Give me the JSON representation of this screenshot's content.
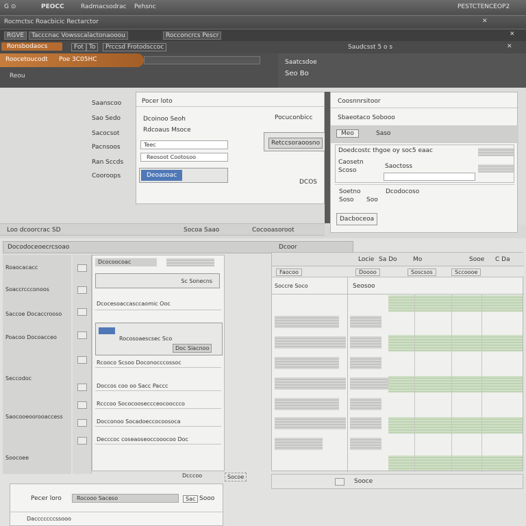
{
  "window": {
    "title": "PEOCC",
    "left_icons": "G ⊙",
    "title_menu": "Radmacsodrac",
    "title_right_label": "Pehsnc",
    "top_right": "PESTCTENCEOP2"
  },
  "toolbar2": {
    "left_text": "Rocmctsc Roacbicic Rectarctor",
    "right_glyph": "✕"
  },
  "menubar": {
    "items": [
      "RGVE",
      "Tacccnac Vowsscalactonaooou",
      "Rocconcrcs Pescr"
    ],
    "close": "✕"
  },
  "tabbar": {
    "tab1": "Ronsbodaocs",
    "tab2_a": "Fot",
    "tab2_b": "To",
    "tab2_c": "Prccsd Frotodsccoc",
    "right_text": "Saudcsst 5 o s",
    "close": "✕"
  },
  "top_left": {
    "highlight": "Roocetoucodt",
    "highlight_value": "Poe 3C05HC",
    "link": "Reou"
  },
  "top_right": {
    "label": "Saatcsdoe",
    "value": "Seo Bo"
  },
  "form": {
    "labels": [
      "Saanscoo",
      "Sao Sedo",
      "Sacocsot",
      "Pacnsoos",
      "Ran Sccds",
      "Cooroops"
    ],
    "section_title": "Pocer loto",
    "name_label": "Dcoinoo Seoh",
    "name_sub": "Rdcoaus Msoce",
    "field1": "Teec",
    "field2": "Reosoot Cootosoo",
    "submit": "Deoasoac",
    "right_title": "Pocuconbicc",
    "right_button": "Retccsoraoosno",
    "code": "DCOS"
  },
  "props": {
    "title": "Coosnnrsitoor",
    "subtitle": "Sbaeotaco Sobooo",
    "tag_a": "Meo",
    "tag_b": "Saso",
    "row1": "Doedcostc thgoe oy soc5 eaac",
    "row2_a": "Caosetn",
    "row2_b": "Scoso",
    "row2_c": "Saoctoss",
    "row3_a": "Soetno",
    "row3_b": "Soso",
    "row3_c": "Dcodocoso",
    "row3_d": "Soo",
    "button": "Dacboceoa"
  },
  "status": {
    "left": "Loo dcoorcrac SD",
    "mid": "Socoa Saao",
    "right": "Cocooasoroot"
  },
  "grid_left": {
    "header": "Docodoceoecrcsoao",
    "header_mid": "Dcoor",
    "side_items": [
      "Roaocacacc",
      "Soaccrccconoos",
      "Saccoe Docaccrooso",
      "Poacoo Docoacceo",
      "Seccodoc",
      "Saocooeoorooaccess",
      "Soocoee"
    ],
    "cells": [
      "Dcocoocoac",
      "Sc Sonecns",
      "Dcocesoaccasccaomic Ooc",
      "Rocosoaescsec Sco",
      "Doc Siacnoo",
      "Rcooco Scsoo Doconocccossoc",
      "Doccos coo oo Sacc Paccc",
      "Rcccoo Sococooseccceocooccco",
      "Docconoo Socadoeccocoosoca",
      "Decccoc coseaoseoccooocoo Doc"
    ],
    "footer_a": "Dcccoo",
    "footer_b": "Socoe"
  },
  "grid_right": {
    "header": [
      "Locie",
      "Sa Do",
      "Mo",
      "Sooe",
      "C Da"
    ],
    "subheader": [
      "Faocoo",
      "Doooo",
      "Soscsos",
      "Sccoooe"
    ],
    "col_title_a": "Soccre Soco",
    "col_title_b": "Seosoo",
    "footer": "Sooce"
  },
  "bottom_pane": {
    "label": "Pecer loro",
    "field": "Rocooo Saceso",
    "chip": "Sac",
    "value": "Sooo",
    "sub": "Dacccccccssooo"
  }
}
